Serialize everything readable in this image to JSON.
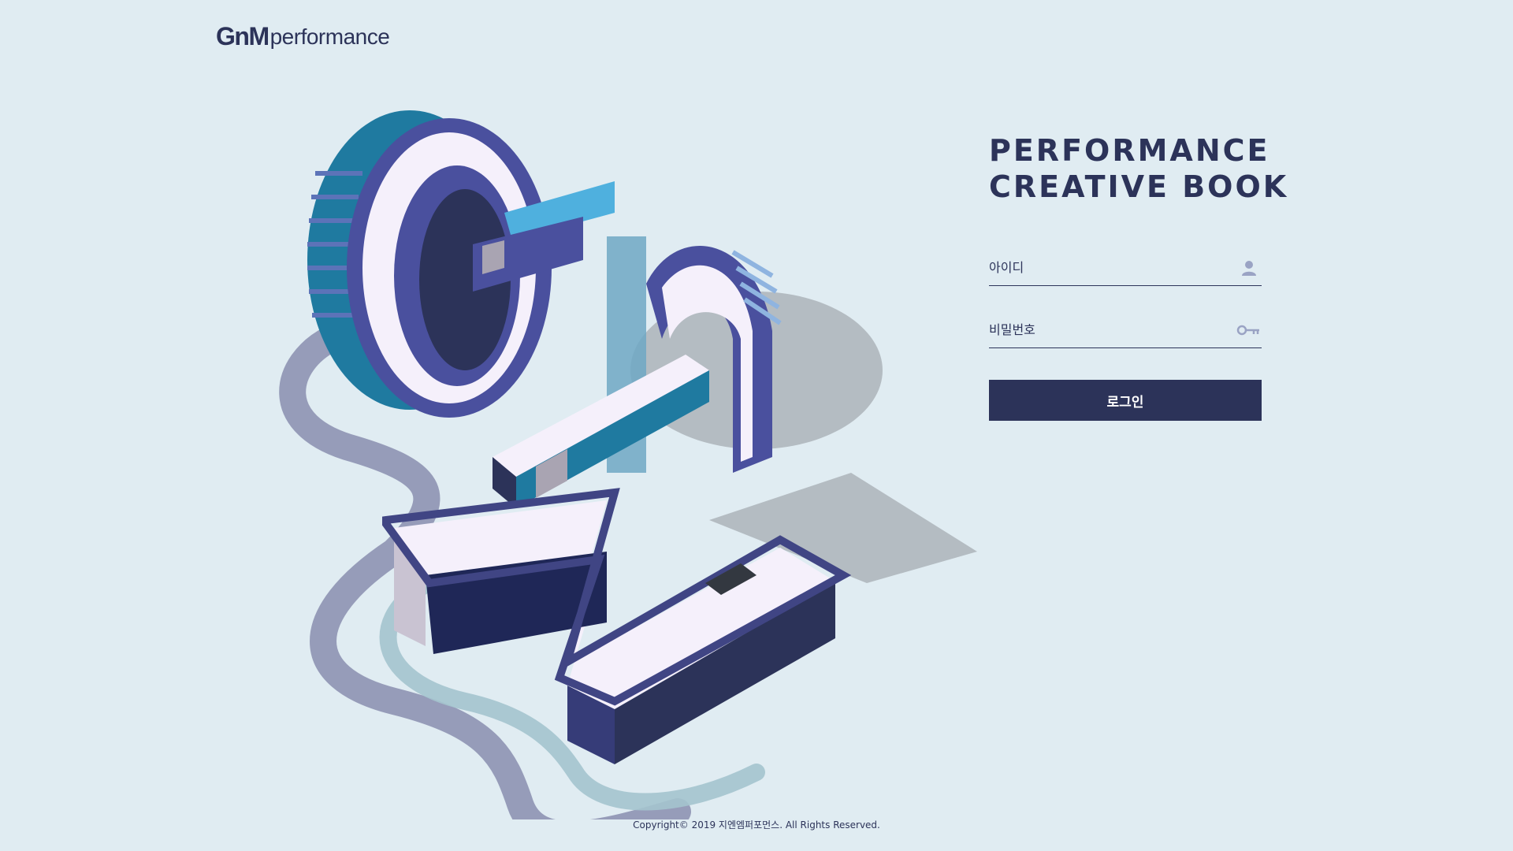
{
  "header": {
    "logo_mark": "GnM",
    "logo_text": "performance"
  },
  "login": {
    "headline_line1": "PERFORMANCE",
    "headline_line2": "CREATIVE BOOK",
    "id_placeholder": "아이디",
    "password_placeholder": "비밀번호",
    "login_button": "로그인"
  },
  "footer": {
    "copyright": "Copyright© 2019 지엔엠퍼포먼스. All Rights Reserved."
  },
  "colors": {
    "background": "#e0ecf2",
    "primary": "#2c3359",
    "icon": "#9aa3c4"
  },
  "icons": {
    "id_field": "user-icon",
    "password_field": "key-icon"
  }
}
